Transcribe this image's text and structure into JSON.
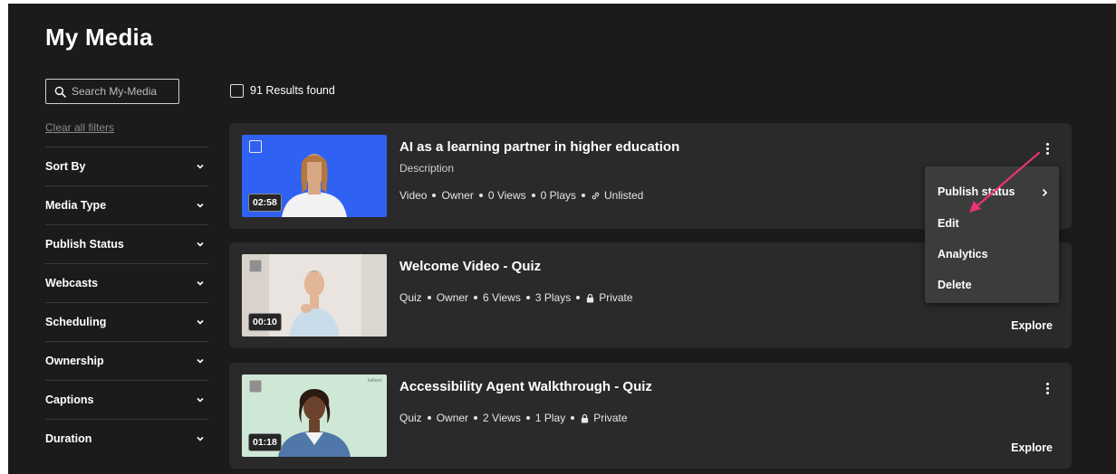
{
  "page": {
    "title": "My Media"
  },
  "search": {
    "placeholder": "Search My-Media"
  },
  "filters": {
    "clear_label": "Clear all filters",
    "items": [
      {
        "label": "Sort By"
      },
      {
        "label": "Media Type"
      },
      {
        "label": "Publish Status"
      },
      {
        "label": "Webcasts"
      },
      {
        "label": "Scheduling"
      },
      {
        "label": "Ownership"
      },
      {
        "label": "Captions"
      },
      {
        "label": "Duration"
      }
    ]
  },
  "results": {
    "count_label": "91 Results found"
  },
  "entries": [
    {
      "title": "AI as a learning partner in higher education",
      "description": "Description",
      "duration": "02:58",
      "type": "Video",
      "role": "Owner",
      "views": "0 Views",
      "plays": "0 Plays",
      "status": "Unlisted",
      "status_icon": "link-icon",
      "thumb_bg": "#2f62f2"
    },
    {
      "title": "Welcome Video - Quiz",
      "duration": "00:10",
      "type": "Quiz",
      "role": "Owner",
      "views": "6 Views",
      "plays": "3 Plays",
      "status": "Private",
      "status_icon": "lock-icon",
      "action": "Explore",
      "thumb_bg": "#e9e4df"
    },
    {
      "title": "Accessibility Agent Walkthrough - Quiz",
      "duration": "01:18",
      "type": "Quiz",
      "role": "Owner",
      "views": "2 Views",
      "plays": "1 Play",
      "status": "Private",
      "status_icon": "lock-icon",
      "action": "Explore",
      "thumb_bg": "#cfe8d6",
      "thumb_watermark": "kaltura"
    }
  ],
  "action_menu": {
    "items": [
      {
        "label": "Publish status"
      },
      {
        "label": "Edit"
      },
      {
        "label": "Analytics"
      },
      {
        "label": "Delete"
      }
    ]
  },
  "colors": {
    "background": "#1b1b1b",
    "card": "#2a2a2a",
    "menu": "#3c3c3c",
    "annotation_arrow": "#e8337a"
  }
}
